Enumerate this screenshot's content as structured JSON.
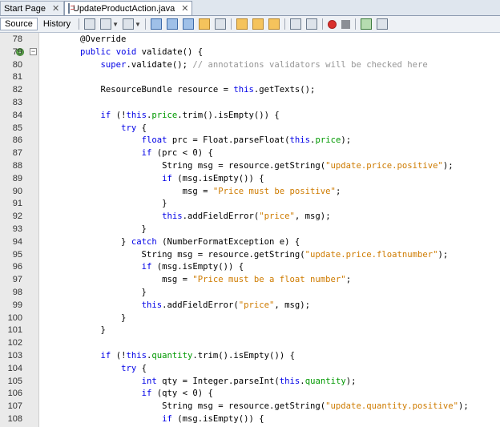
{
  "tabs": [
    {
      "label": "Start Page",
      "close": "✕"
    },
    {
      "label": "UpdateProductAction.java",
      "close": "✕"
    }
  ],
  "toolbar": {
    "source": "Source",
    "history": "History"
  },
  "lines": [
    {
      "n": "78",
      "text": "        @Override"
    },
    {
      "n": "79",
      "text": "        public void validate() {"
    },
    {
      "n": "80",
      "text": "            super.validate(); // annotations validators will be checked here"
    },
    {
      "n": "81",
      "text": ""
    },
    {
      "n": "82",
      "text": "            ResourceBundle resource = this.getTexts();"
    },
    {
      "n": "83",
      "text": ""
    },
    {
      "n": "84",
      "text": "            if (!this.price.trim().isEmpty()) {"
    },
    {
      "n": "85",
      "text": "                try {"
    },
    {
      "n": "86",
      "text": "                    float prc = Float.parseFloat(this.price);"
    },
    {
      "n": "87",
      "text": "                    if (prc < 0) {"
    },
    {
      "n": "88",
      "text": "                        String msg = resource.getString(\"update.price.positive\");"
    },
    {
      "n": "89",
      "text": "                        if (msg.isEmpty()) {"
    },
    {
      "n": "90",
      "text": "                            msg = \"Price must be positive\";"
    },
    {
      "n": "91",
      "text": "                        }"
    },
    {
      "n": "92",
      "text": "                        this.addFieldError(\"price\", msg);"
    },
    {
      "n": "93",
      "text": "                    }"
    },
    {
      "n": "94",
      "text": "                } catch (NumberFormatException e) {"
    },
    {
      "n": "95",
      "text": "                    String msg = resource.getString(\"update.price.floatnumber\");"
    },
    {
      "n": "96",
      "text": "                    if (msg.isEmpty()) {"
    },
    {
      "n": "97",
      "text": "                        msg = \"Price must be a float number\";"
    },
    {
      "n": "98",
      "text": "                    }"
    },
    {
      "n": "99",
      "text": "                    this.addFieldError(\"price\", msg);"
    },
    {
      "n": "100",
      "text": "                }"
    },
    {
      "n": "101",
      "text": "            }"
    },
    {
      "n": "102",
      "text": ""
    },
    {
      "n": "103",
      "text": "            if (!this.quantity.trim().isEmpty()) {"
    },
    {
      "n": "104",
      "text": "                try {"
    },
    {
      "n": "105",
      "text": "                    int qty = Integer.parseInt(this.quantity);"
    },
    {
      "n": "106",
      "text": "                    if (qty < 0) {"
    },
    {
      "n": "107",
      "text": "                        String msg = resource.getString(\"update.quantity.positive\");"
    },
    {
      "n": "108",
      "text": "                        if (msg.isEmpty()) {"
    }
  ]
}
